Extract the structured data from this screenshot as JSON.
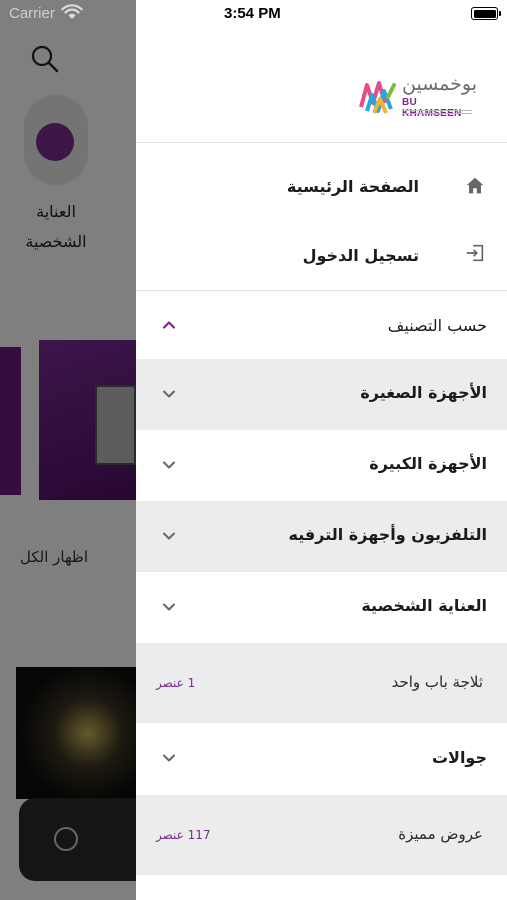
{
  "status_bar": {
    "carrier": "Carrier",
    "time": "3:54 PM"
  },
  "background": {
    "category_label": "العناية الشخصية",
    "show_all": "اظهار الكل"
  },
  "drawer": {
    "logo": {
      "arabic": "بوخمسين",
      "english": "BU KHAMSEEN"
    },
    "nav": [
      {
        "label": "الصفحة الرئيسية",
        "icon": "home-icon"
      },
      {
        "label": "تسجيل الدخول",
        "icon": "login-icon"
      }
    ],
    "categories_header": {
      "label": "حسب التصنيف",
      "expanded": true
    },
    "categories": [
      {
        "label": "الأجهزة الصغيرة",
        "type": "expandable"
      },
      {
        "label": "الأجهزة الكبيرة",
        "type": "expandable"
      },
      {
        "label": "التلفزيون وأجهزة الترفيه",
        "type": "expandable"
      },
      {
        "label": "العناية الشخصية",
        "type": "expandable"
      },
      {
        "label": "ثلاجة باب واحد",
        "type": "leaf",
        "count": "1 عنصر"
      },
      {
        "label": "جوالات",
        "type": "expandable"
      },
      {
        "label": "عروض مميزة",
        "type": "leaf",
        "count": "117 عنصر"
      }
    ]
  },
  "colors": {
    "accent": "#7a2a8e",
    "dim_overlay": "rgba(0,0,0,0.5)",
    "row_alt": "#ececec"
  }
}
